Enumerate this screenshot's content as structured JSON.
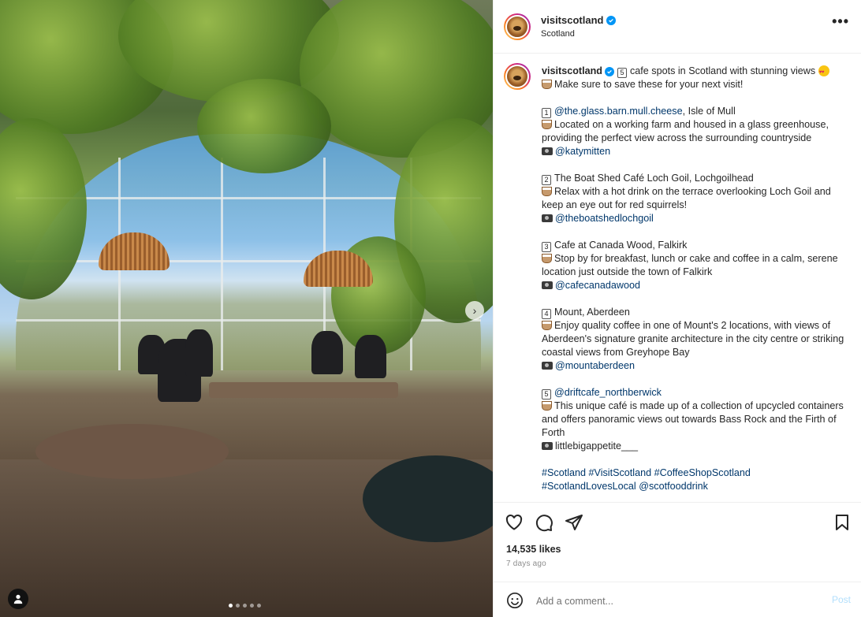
{
  "post": {
    "username": "visitscotland",
    "location": "Scotland",
    "more_label": "•••"
  },
  "caption": {
    "username": "visitscotland",
    "intro_line1": "cafe spots in Scotland with stunning views",
    "intro_num": "5",
    "intro_line2": "Make sure to save these for your next visit!",
    "items": [
      {
        "num": "1",
        "title_link": "@the.glass.barn.mull.cheese",
        "title_rest": ", Isle of Mull",
        "desc": "Located on a working farm and housed in a glass greenhouse, providing the perfect view across the surrounding countryside",
        "credit": "@katymitten"
      },
      {
        "num": "2",
        "title_link": "",
        "title_rest": "The Boat Shed Café Loch Goil, Lochgoilhead",
        "desc": "Relax with a hot drink on the terrace overlooking Loch Goil and keep an eye out for red squirrels!",
        "credit": "@theboatshedlochgoil"
      },
      {
        "num": "3",
        "title_link": "",
        "title_rest": "Cafe at Canada Wood, Falkirk",
        "desc": "Stop by for breakfast, lunch or cake and coffee in a calm, serene location just outside the town of Falkirk",
        "credit": "@cafecanadawood"
      },
      {
        "num": "4",
        "title_link": "",
        "title_rest": "Mount, Aberdeen",
        "desc": "Enjoy quality coffee in one of Mount's 2 locations, with views of Aberdeen's signature granite architecture in the city centre or striking coastal views from Greyhope Bay",
        "credit": "@mountaberdeen"
      },
      {
        "num": "5",
        "title_link": "@driftcafe_northberwick",
        "title_rest": "",
        "desc": "This unique café is made up of a collection of upcycled containers and offers panoramic views out towards Bass Rock and the Firth of Forth",
        "credit": "littlebigappetite___"
      }
    ],
    "hashtags_line1": "#Scotland #VisitScotland #CoffeeShopScotland",
    "hashtags_line2": "#ScotlandLovesLocal @scotfooddrink"
  },
  "stats": {
    "likes": "14,535 likes",
    "time_ago": "7 days ago"
  },
  "comment": {
    "placeholder": "Add a comment...",
    "post_label": "Post"
  },
  "carousel": {
    "total": 5,
    "current": 1
  },
  "icons": {
    "like": "heart-icon",
    "comment": "comment-icon",
    "share": "send-icon",
    "save": "bookmark-icon",
    "emoji": "smiley-icon",
    "next": "chevron-right-icon",
    "user_tag": "person-icon",
    "verified": "verified-badge-icon"
  },
  "colors": {
    "link": "#00376b",
    "verified": "#0095f6",
    "post_disabled": "#b2dffc"
  }
}
